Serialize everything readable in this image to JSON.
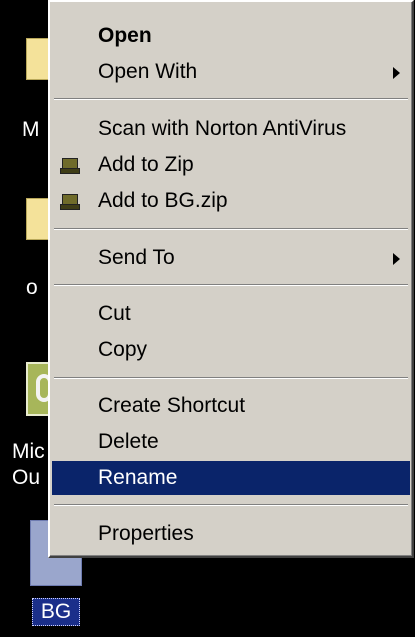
{
  "desktop": {
    "icons": [
      {
        "name": "folder",
        "label": "M"
      },
      {
        "name": "folder",
        "label": "o"
      },
      {
        "name": "outlook",
        "label_line1": "Mic",
        "label_line2": "Ou"
      },
      {
        "name": "bg-file",
        "label": "BG"
      }
    ]
  },
  "context_menu": {
    "items": [
      {
        "id": "open",
        "label": "Open",
        "default": true
      },
      {
        "id": "open-with",
        "label": "Open With",
        "submenu": true
      },
      {
        "id": "scan",
        "label": "Scan with Norton AntiVirus"
      },
      {
        "id": "add-to-zip",
        "label": "Add to Zip",
        "icon": "zip-icon"
      },
      {
        "id": "add-to-bgzip",
        "label": "Add to BG.zip",
        "icon": "zip-icon"
      },
      {
        "id": "send-to",
        "label": "Send To",
        "submenu": true
      },
      {
        "id": "cut",
        "label": "Cut"
      },
      {
        "id": "copy",
        "label": "Copy"
      },
      {
        "id": "create-shortcut",
        "label": "Create Shortcut"
      },
      {
        "id": "delete",
        "label": "Delete"
      },
      {
        "id": "rename",
        "label": "Rename",
        "selected": true
      },
      {
        "id": "properties",
        "label": "Properties"
      }
    ]
  },
  "colors": {
    "menu_bg": "#d4d0c8",
    "highlight": "#0a246a",
    "desktop": "#000000"
  }
}
